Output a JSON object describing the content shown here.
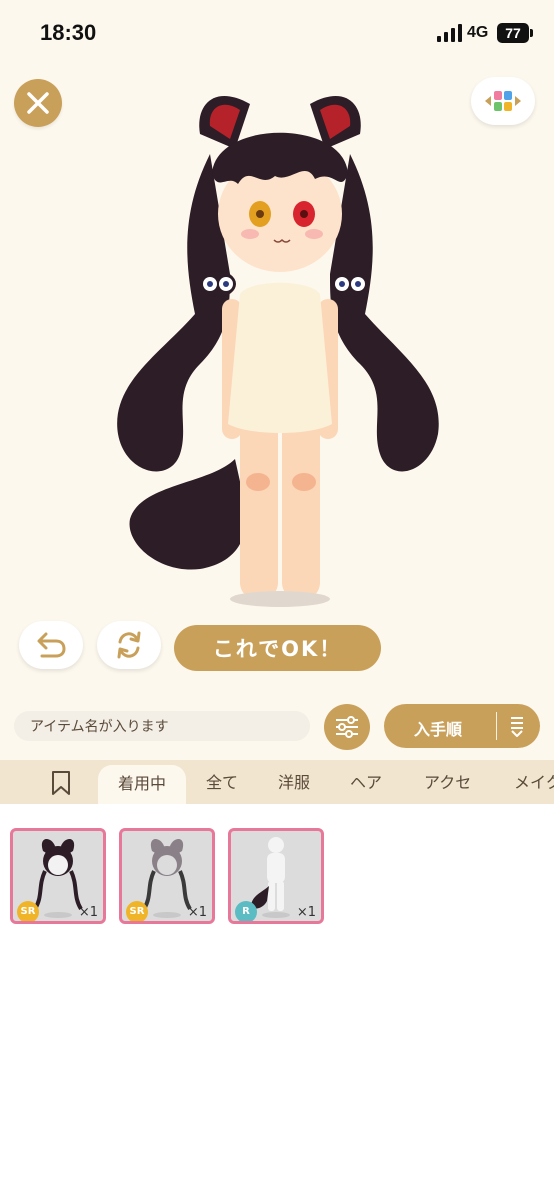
{
  "status_bar": {
    "time": "18:30",
    "network": "4G",
    "battery": "77"
  },
  "actions": {
    "ok_label": "これでOK！"
  },
  "search": {
    "placeholder": "アイテム名が入ります"
  },
  "sort": {
    "label": "入手順"
  },
  "tabs": [
    "着用中",
    "全て",
    "洋服",
    "ヘア",
    "アクセ",
    "メイク"
  ],
  "items": [
    {
      "rarity": "SR",
      "rarity_color": "#f0b429",
      "quantity": "×1",
      "type": "hair-with-cat-ears"
    },
    {
      "rarity": "SR",
      "rarity_color": "#f0b429",
      "quantity": "×1",
      "type": "hair-gray"
    },
    {
      "rarity": "R",
      "rarity_color": "#5bbcc3",
      "quantity": "×1",
      "type": "tail-body"
    }
  ],
  "colors": {
    "accent": "#c9a05a",
    "card_border": "#e8789a",
    "tab_bar": "#f1e5cf"
  }
}
